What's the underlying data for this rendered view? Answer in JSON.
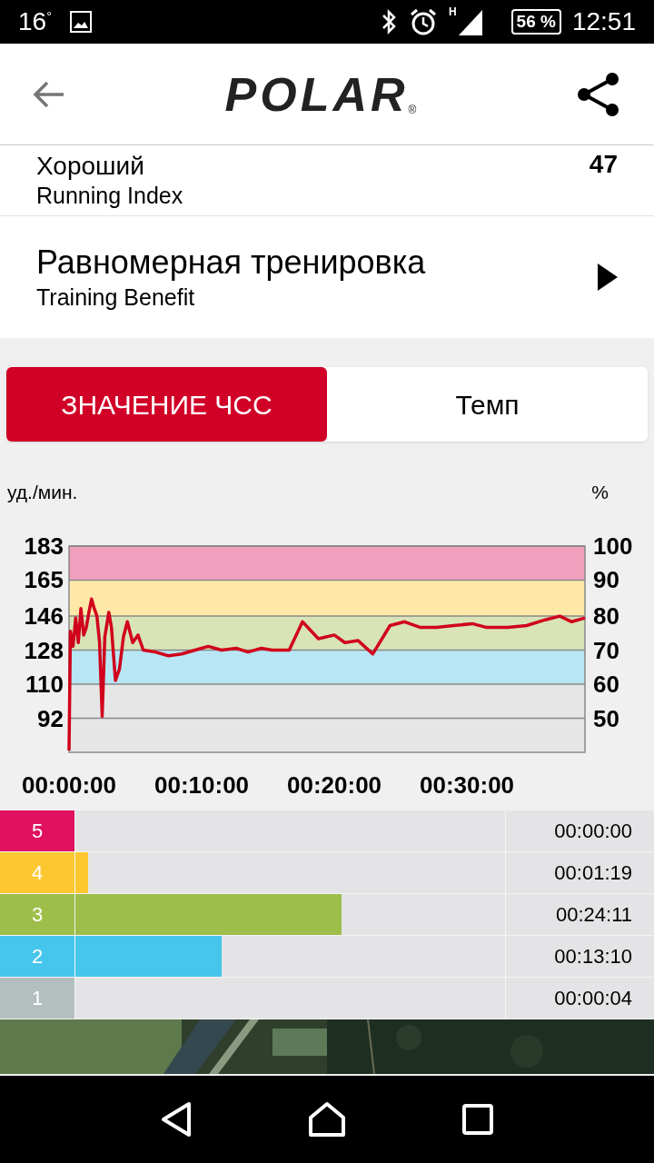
{
  "status_bar": {
    "temperature": "16",
    "degree": "°",
    "network": "H",
    "battery": "56 %",
    "time": "12:51"
  },
  "header": {
    "logo": "POLAR",
    "registered": "®"
  },
  "summary_rows": [
    {
      "value": "Хороший",
      "label": "Running Index",
      "number": "47",
      "has_arrow": false
    },
    {
      "value": "Равномерная тренировка",
      "label": "Training Benefit",
      "has_arrow": true
    }
  ],
  "tabs": [
    {
      "label": "ЗНАЧЕНИЕ ЧСС",
      "selected": true
    },
    {
      "label": "Темп",
      "selected": false
    }
  ],
  "chart": {
    "left_title": "уд./мин.",
    "right_title": "%",
    "right_ticks": [
      "100",
      "90",
      "80",
      "70",
      "60",
      "50"
    ],
    "chart_data": {
      "type": "line",
      "xlim": [
        0,
        38.9
      ],
      "ylim": [
        74,
        183
      ],
      "xticks": [
        {
          "value": 0,
          "label": "00:00:00"
        },
        {
          "value": 10,
          "label": "00:10:00"
        },
        {
          "value": 20,
          "label": "00:20:00"
        },
        {
          "value": 30,
          "label": "00:30:00"
        }
      ],
      "yticks": [
        92,
        110,
        128,
        146,
        165,
        183
      ],
      "grid": true,
      "bands": [
        {
          "axis": "y",
          "from": 110,
          "to": 128,
          "color": "#b8e6f4"
        },
        {
          "axis": "y",
          "from": 128,
          "to": 146,
          "color": "#d8e4b8"
        },
        {
          "axis": "y",
          "from": 146,
          "to": 165,
          "color": "#fde8a8"
        },
        {
          "axis": "y",
          "from": 165,
          "to": 183,
          "color": "#f0a0bc"
        }
      ],
      "x": [
        0,
        0.1,
        0.3,
        0.5,
        0.7,
        0.9,
        1.1,
        1.3,
        1.5,
        1.7,
        1.9,
        2.1,
        2.3,
        2.5,
        2.7,
        3.0,
        3.2,
        3.5,
        3.8,
        4.1,
        4.4,
        4.8,
        5.2,
        5.6,
        6.5,
        7.5,
        8.5,
        9.5,
        10.5,
        11.5,
        12.6,
        13.5,
        14.5,
        15.3,
        16.6,
        17.6,
        18.8,
        20.0,
        20.8,
        21.8,
        22.9,
        24.2,
        25.3,
        26.5,
        27.7,
        29.0,
        30.4,
        31.5,
        33.1,
        34.5,
        35.9,
        37.0,
        37.9,
        38.9
      ],
      "series": [
        {
          "color": "#d0021b",
          "values": [
            75,
            138,
            130,
            145,
            132,
            150,
            136,
            140,
            148,
            155,
            150,
            146,
            132,
            93,
            135,
            148,
            140,
            112,
            118,
            135,
            143,
            132,
            136,
            128,
            127,
            125,
            126,
            128,
            130,
            128,
            129,
            127,
            129,
            128,
            128,
            143,
            134,
            136,
            132,
            133,
            126,
            141,
            143,
            140,
            140,
            141,
            142,
            140,
            140,
            141,
            144,
            146,
            143,
            145
          ]
        }
      ]
    }
  },
  "zones": [
    {
      "zone": "5",
      "color": "#e0115f",
      "time": "00:00:00"
    },
    {
      "zone": "4",
      "color": "#fdc82f",
      "level": 0.03,
      "time": "00:01:19"
    },
    {
      "zone": "3",
      "color": "#9ebe4a",
      "level": 0.62,
      "time": "00:24:11"
    },
    {
      "zone": "2",
      "color": "#46c6ec",
      "level": 0.34,
      "time": "00:13:10"
    },
    {
      "zone": "1",
      "color": "#b4bebe",
      "time": "00:00:04"
    }
  ]
}
